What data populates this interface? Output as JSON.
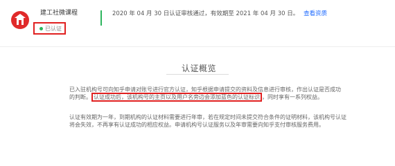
{
  "header": {
    "org_name": "建工社微课程",
    "badge_label": "已认证",
    "notice_text": "2020 年 04 月 30 日认证审核通过，有效期至 2021 年 04 月 30 日。",
    "notice_link": "查看资质"
  },
  "section": {
    "title": "认证概览",
    "para1_line1": "已入驻机构号可向知乎申请对账号进行官方认证，知乎根据申请提交的资料及信息进行审核，作出认证是否成功",
    "para1_line2_pre": "的判断。",
    "para1_highlight": "认证成功后，该机构号的主页以及用户名旁边会添加蓝色的认证标识",
    "para1_line2_post": "，同时享有一系列权益。",
    "para2_line1": "认证有效期为一年，到期机构的认证材料需要进行年审，若在规定时间未提交符合条件的证明材料，该机构号认证",
    "para2_line2": "将会失效，不再享有认证成功的相应权益。申请机构号认证服务以及年审需要向知乎支付审核服务费用。"
  },
  "colors": {
    "highlight_border": "#e02020",
    "status_green": "#2db55d",
    "link_blue": "#1f6bff"
  }
}
